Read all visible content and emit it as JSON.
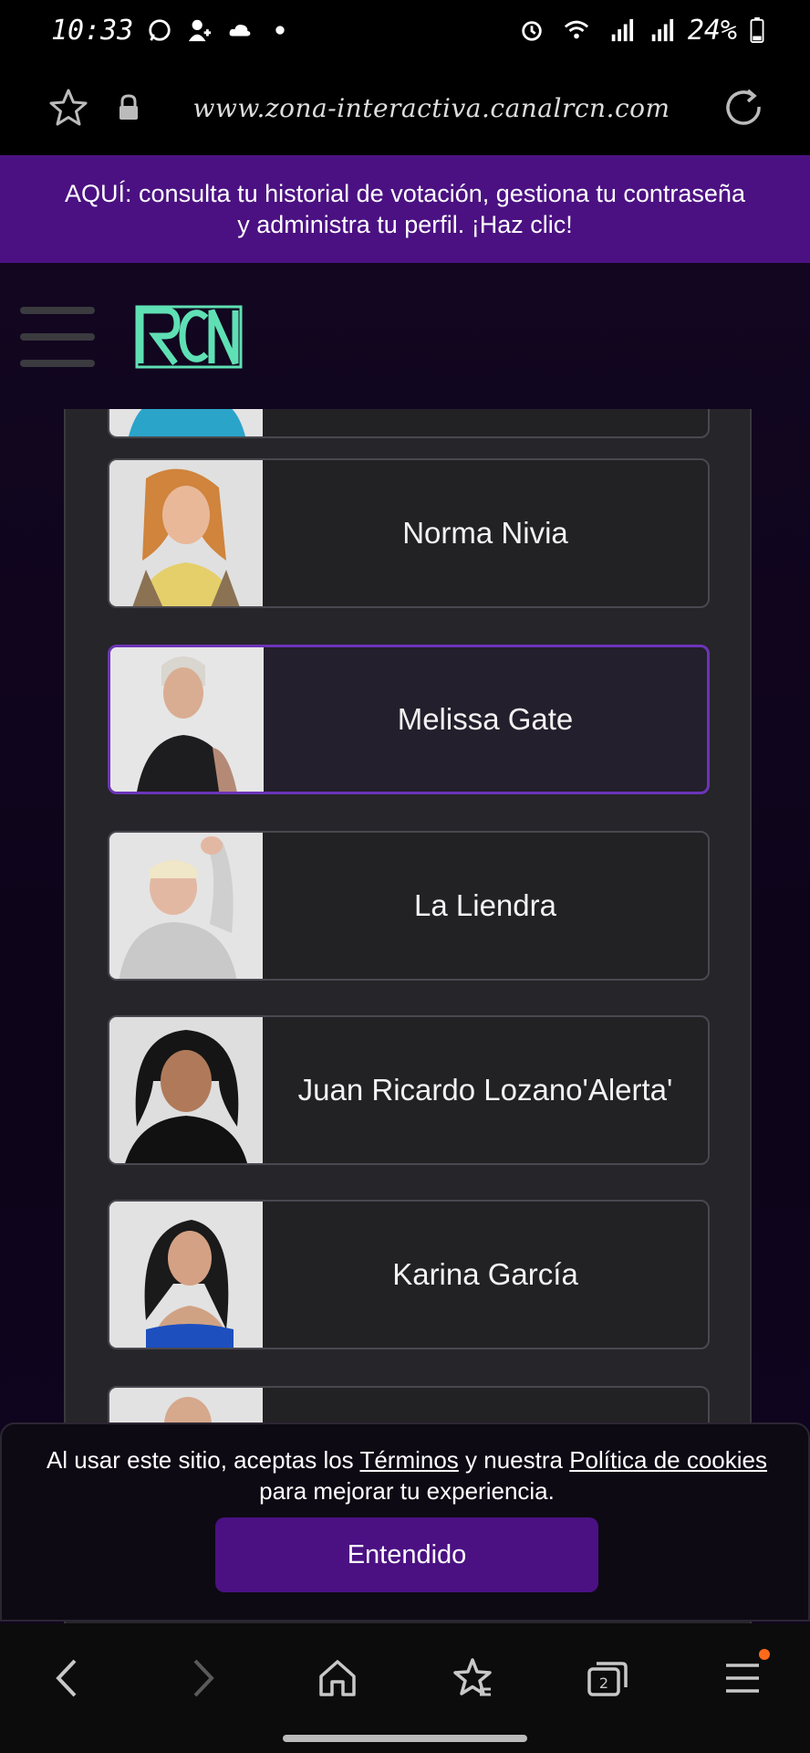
{
  "status_bar": {
    "time": "10:33",
    "battery": "24%"
  },
  "browser": {
    "url": "www.zona-interactiva.canalrcn.com"
  },
  "promo": {
    "line1": "AQUÍ: consulta tu historial de votación, gestiona tu contraseña",
    "line2": "y administra tu perfil. ¡Haz clic!"
  },
  "contestants": [
    {
      "name": "Norma Nivia",
      "selected": false
    },
    {
      "name": "Melissa Gate",
      "selected": true
    },
    {
      "name": "La Liendra",
      "selected": false
    },
    {
      "name": "Juan Ricardo Lozano",
      "name2": "'Alerta'",
      "selected": false
    },
    {
      "name": "Karina García",
      "selected": false
    }
  ],
  "cookie": {
    "text_before": "Al usar este sitio, aceptas los ",
    "terms_link": "Términos",
    "text_middle": " y nuestra ",
    "policy_link": "Política de cookies",
    "text_after": "para mejorar tu experiencia.",
    "button": "Entendido"
  },
  "colors": {
    "accent": "#4b1182",
    "selected_border": "#6c34b8",
    "logo": "#5fe0b4",
    "notification_dot": "#ff6a1a"
  }
}
